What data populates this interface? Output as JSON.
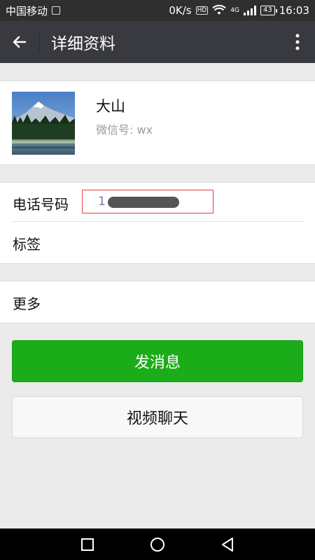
{
  "status_bar": {
    "carrier": "中国移动",
    "speed": "0K/s",
    "hd_badge": "HD",
    "network": "4G",
    "battery": "43",
    "time": "16:03"
  },
  "title_bar": {
    "title": "详细资料",
    "back_icon": "arrow-left-icon",
    "menu_icon": "more-vertical-icon"
  },
  "profile": {
    "name": "大山",
    "wechat_id": "微信号: wx"
  },
  "info": {
    "phone_label": "电话号码",
    "phone_value": "1",
    "tags_label": "标签"
  },
  "more": {
    "label": "更多"
  },
  "buttons": {
    "send_message": "发消息",
    "video_call": "视频聊天"
  },
  "colors": {
    "primary_green": "#1aad19",
    "titlebar_bg": "#393a3f",
    "highlight_border": "#e84040"
  }
}
